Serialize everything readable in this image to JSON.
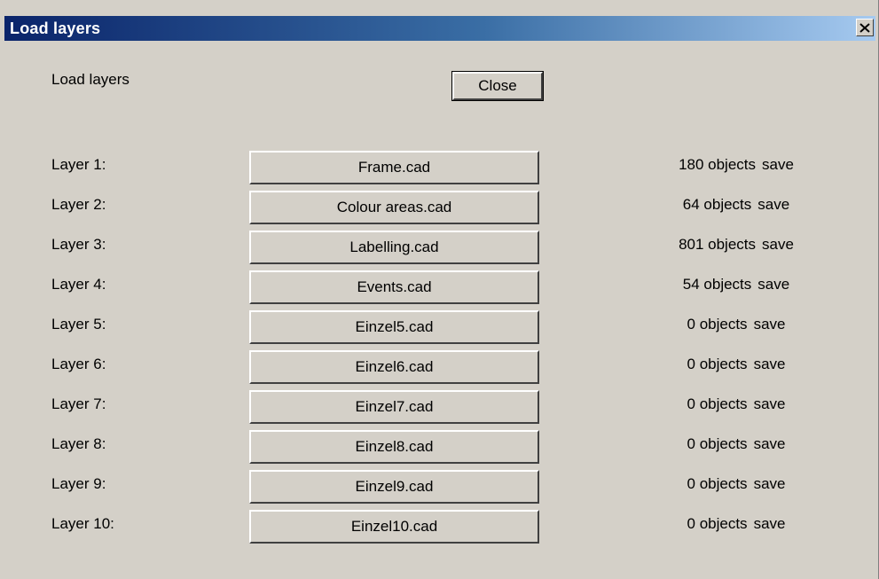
{
  "window": {
    "title": "Load layers",
    "close_icon": "close-x-icon"
  },
  "header_label": "Load layers",
  "close_button_label": "Close",
  "layers": [
    {
      "label": "Layer  1:",
      "file": "Frame.cad",
      "objects": "180 objects",
      "save": "save"
    },
    {
      "label": "Layer  2:",
      "file": "Colour areas.cad",
      "objects": "64 objects",
      "save": "save"
    },
    {
      "label": "Layer  3:",
      "file": "Labelling.cad",
      "objects": "801 objects",
      "save": "save"
    },
    {
      "label": "Layer  4:",
      "file": "Events.cad",
      "objects": "54 objects",
      "save": "save"
    },
    {
      "label": "Layer  5:",
      "file": "Einzel5.cad",
      "objects": "0 objects",
      "save": "save"
    },
    {
      "label": "Layer  6:",
      "file": "Einzel6.cad",
      "objects": "0 objects",
      "save": "save"
    },
    {
      "label": "Layer  7:",
      "file": "Einzel7.cad",
      "objects": "0 objects",
      "save": "save"
    },
    {
      "label": "Layer  8:",
      "file": "Einzel8.cad",
      "objects": "0 objects",
      "save": "save"
    },
    {
      "label": "Layer  9:",
      "file": "Einzel9.cad",
      "objects": "0 objects",
      "save": "save"
    },
    {
      "label": "Layer 10:",
      "file": "Einzel10.cad",
      "objects": "0 objects",
      "save": "save"
    }
  ],
  "colors": {
    "title_gradient_start": "#0a246a",
    "title_gradient_end": "#a6caf0",
    "dialog_background": "#d4d0c8"
  }
}
